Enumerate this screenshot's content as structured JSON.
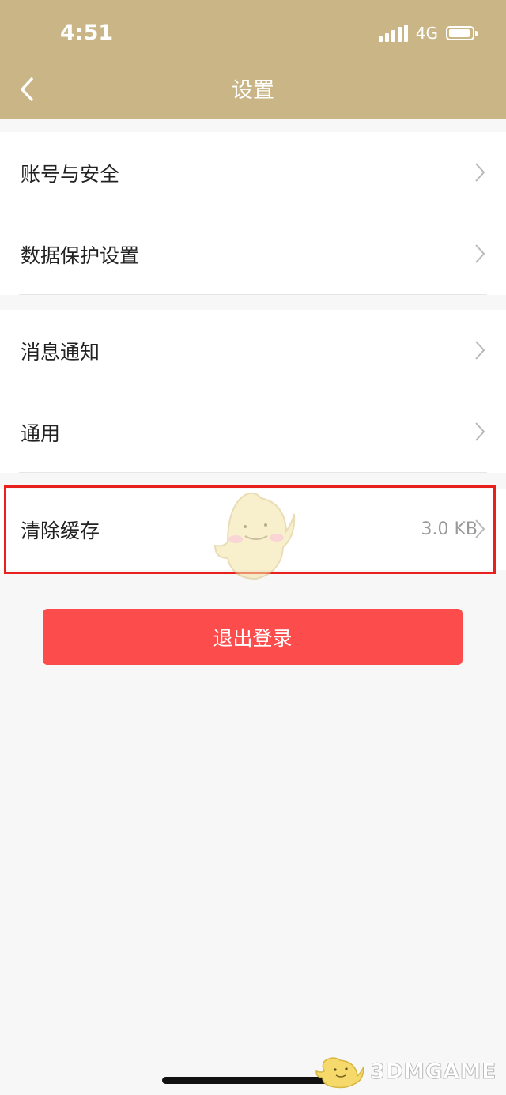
{
  "status_bar": {
    "time": "4:51",
    "network": "4G"
  },
  "header": {
    "title": "设置",
    "back_icon": "chevron-left-icon"
  },
  "groups": [
    {
      "items": [
        {
          "label": "账号与安全"
        },
        {
          "label": "数据保护设置"
        }
      ]
    },
    {
      "items": [
        {
          "label": "消息通知"
        },
        {
          "label": "通用"
        }
      ]
    },
    {
      "items": [
        {
          "label": "清除缓存",
          "value": "3.0 KB"
        }
      ]
    }
  ],
  "logout": {
    "label": "退出登录"
  },
  "watermark": {
    "text": "3DMGAME"
  },
  "colors": {
    "header": "#c9b585",
    "logout": "#fd4c4c",
    "highlight": "#e8211f"
  }
}
